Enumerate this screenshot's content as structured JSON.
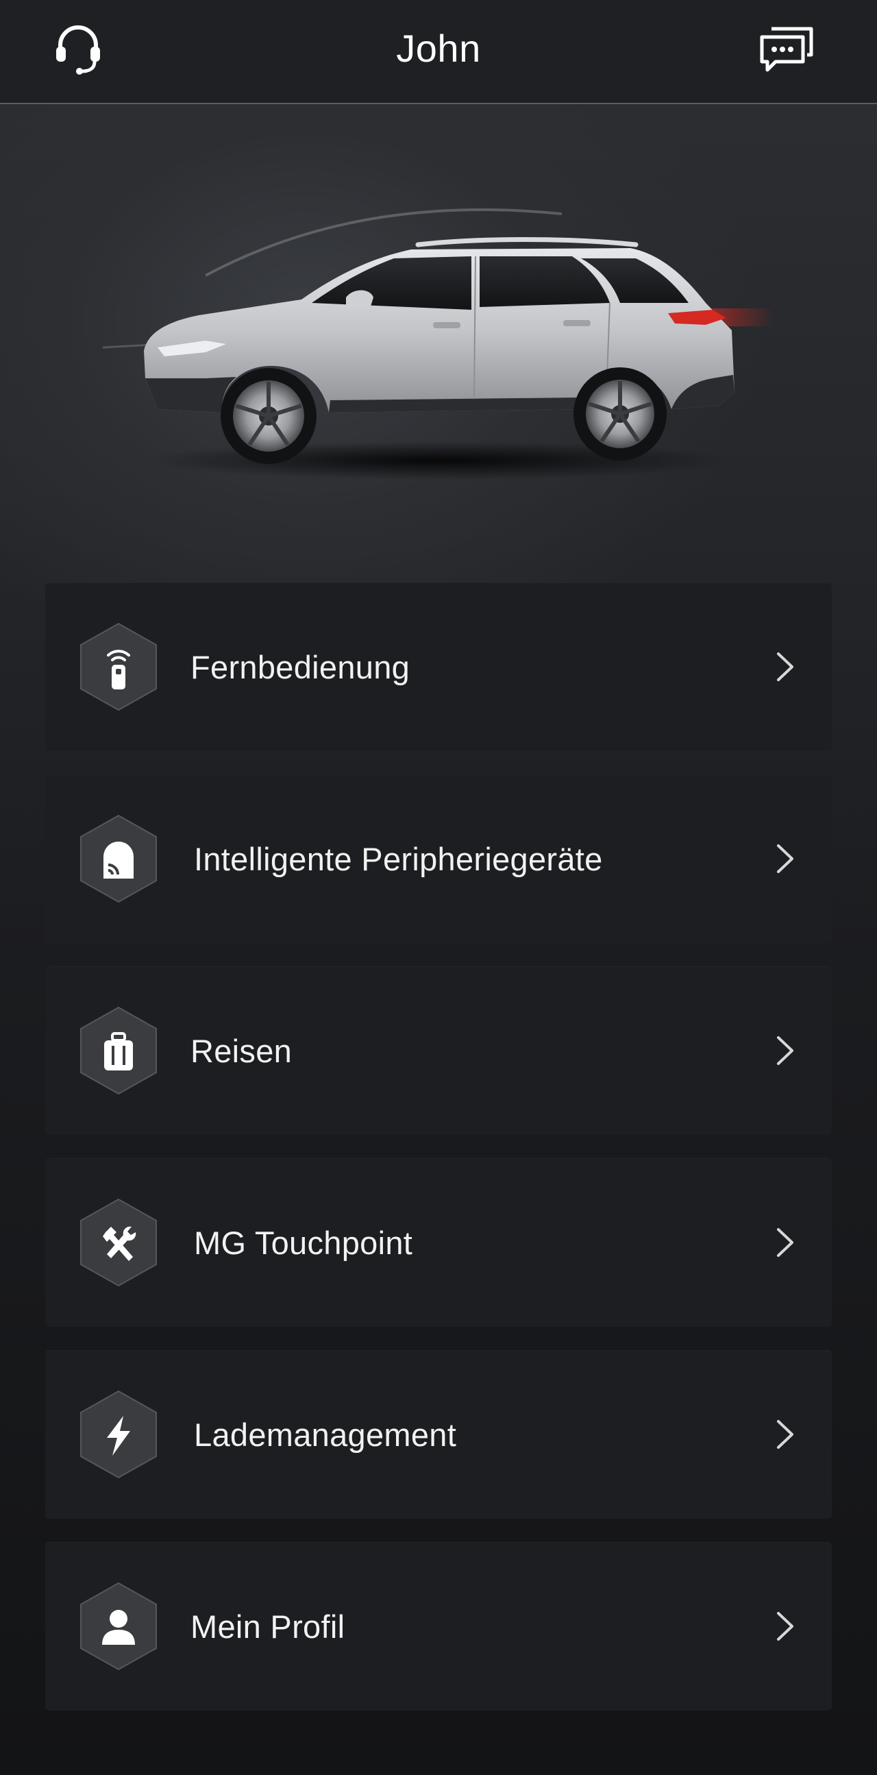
{
  "header": {
    "title": "John",
    "left_icon": "headset-icon",
    "right_icon": "messages-icon"
  },
  "hero": {
    "image": "car-side-view",
    "car_color": "#c9cace",
    "tail_light_color": "#e0281e"
  },
  "menu": {
    "items": [
      {
        "label": "Fernbedienung",
        "icon": "remote-key-icon"
      },
      {
        "label": "Intelligente Peripheriegeräte",
        "icon": "smart-device-icon"
      },
      {
        "label": "Reisen",
        "icon": "suitcase-icon"
      },
      {
        "label": "MG Touchpoint",
        "icon": "tools-icon"
      },
      {
        "label": "Lademanagement",
        "icon": "lightning-icon"
      },
      {
        "label": "Mein Profil",
        "icon": "profile-icon"
      }
    ]
  },
  "colors": {
    "background": "#25272b",
    "card": "#1d1e21",
    "hexagon": "#3a3c40",
    "text": "#ffffff",
    "chevron": "#d8d8d8"
  }
}
